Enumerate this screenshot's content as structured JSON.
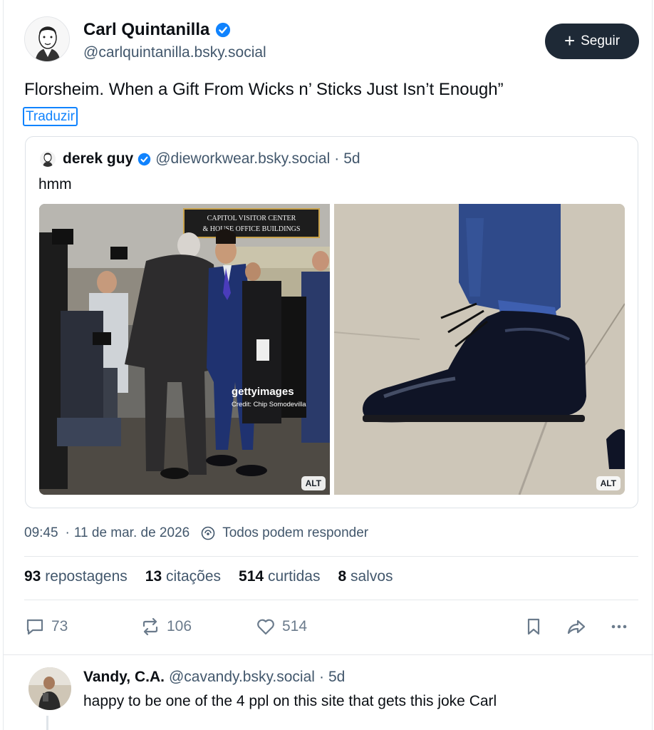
{
  "author": {
    "name": "Carl Quintanilla",
    "handle": "@carlquintanilla.bsky.social",
    "verified": true,
    "accent": "#1083fe"
  },
  "follow": {
    "label": "Seguir"
  },
  "post": {
    "text": "Florsheim. When a Gift From Wicks n’ Sticks Just Isn’t Enough”",
    "translate_label": "Traduzir"
  },
  "quote": {
    "name": "derek guy",
    "handle": "@dieworkwear.bsky.social",
    "age": "5d",
    "text": "hmm",
    "images": [
      {
        "alt_badge": "ALT",
        "sign_line1": "CAPITOL VISITOR CENTER",
        "sign_line2": "& HOUSE OFFICE BUILDINGS",
        "watermark": "gettyimages",
        "credit": "Credit: Chip Somodevilla"
      },
      {
        "alt_badge": "ALT"
      }
    ]
  },
  "meta": {
    "time": "09:45",
    "date": "11 de mar. de 2026",
    "reply_setting": "Todos podem responder"
  },
  "stats": [
    {
      "count": "93",
      "label": "repostagens"
    },
    {
      "count": "13",
      "label": "citações"
    },
    {
      "count": "514",
      "label": "curtidas"
    },
    {
      "count": "8",
      "label": "salvos"
    }
  ],
  "actions": {
    "replies": "73",
    "reposts": "106",
    "likes": "514"
  },
  "reply": {
    "name": "Vandy, C.A.",
    "handle": "@cavandy.bsky.social",
    "age": "5d",
    "text": "happy to be one of the 4 ppl on this site that gets this joke Carl"
  }
}
